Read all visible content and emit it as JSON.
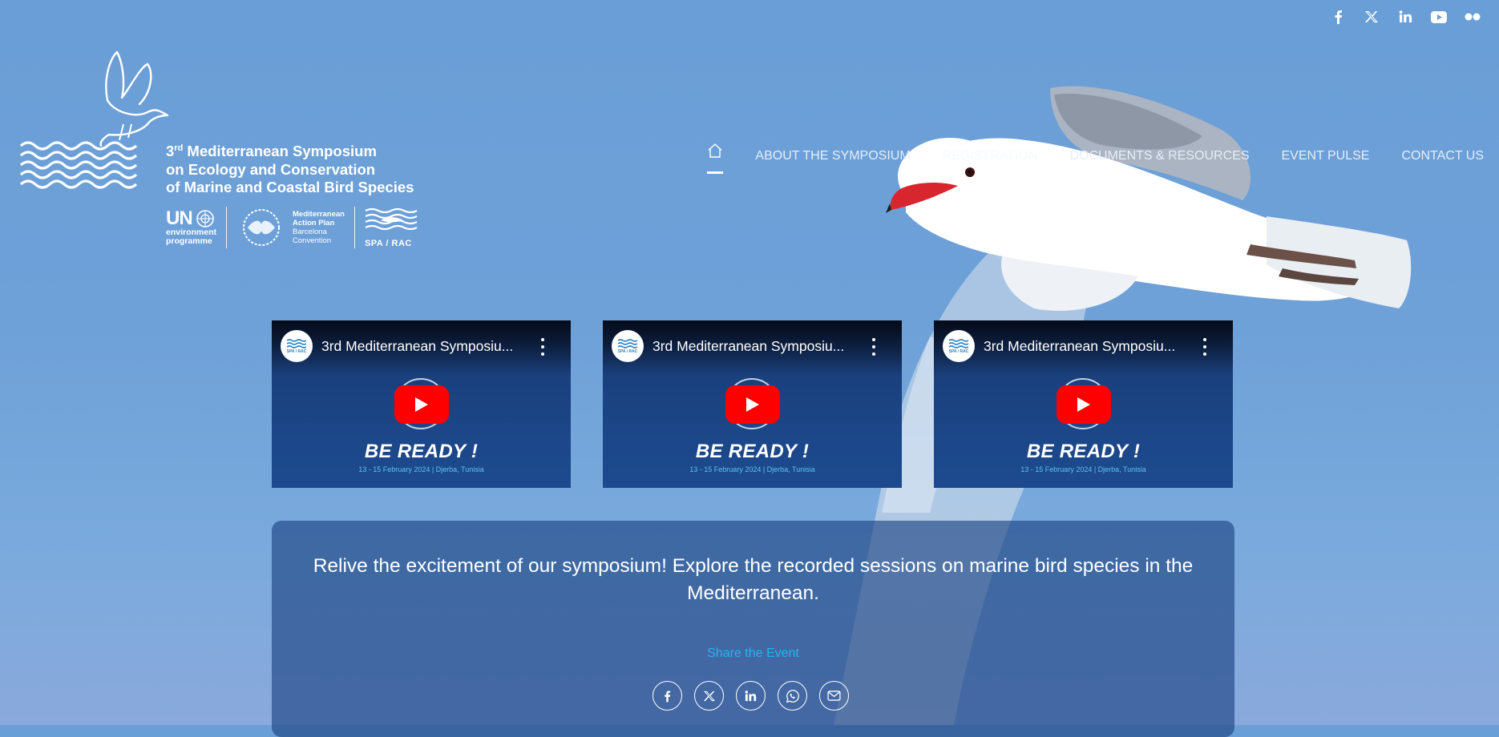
{
  "colors": {
    "sky": "#6a9ed6",
    "nav_text": "#e6eef8",
    "video_bg": "#1c4789",
    "youtube_red": "#ff0000",
    "date_blue": "#5ec3f2",
    "share_blue": "#22b4f0",
    "panel_bg": "rgba(26,64,128,.62)"
  },
  "top_social": [
    {
      "icon": "facebook-icon"
    },
    {
      "icon": "x-twitter-icon"
    },
    {
      "icon": "linkedin-icon"
    },
    {
      "icon": "youtube-icon"
    },
    {
      "icon": "flickr-icon"
    }
  ],
  "logo": {
    "title_num": "3",
    "title_sup": "rd",
    "title_line1_rest": " Mediterranean Symposium",
    "title_line2": "on Ecology and Conservation",
    "title_line3": "of Marine and Coastal Bird Species",
    "un": "UN",
    "un_sub1": "environment",
    "un_sub2": "programme",
    "map_line1": "Mediterranean",
    "map_line2": "Action Plan",
    "map_line3": "Barcelona",
    "map_line4": "Convention",
    "sparac": "SPA / RAC"
  },
  "nav": {
    "home_icon": "home-icon",
    "items": [
      "ABOUT THE SYMPOSIUM",
      "REGISTRATION",
      "DOCUMENTS & RESOURCES",
      "EVENT PULSE",
      "CONTACT US"
    ]
  },
  "videos": [
    {
      "title": "3rd Mediterranean Symposiu...",
      "ready": "BE READY !",
      "date": "13 - 15 February 2024 | Djerba, Tunisia",
      "avatar_label": "SPA / RAC"
    },
    {
      "title": "3rd Mediterranean Symposiu...",
      "ready": "BE READY !",
      "date": "13 - 15 February 2024 | Djerba, Tunisia",
      "avatar_label": "SPA / RAC"
    },
    {
      "title": "3rd Mediterranean Symposiu...",
      "ready": "BE READY !",
      "date": "13 - 15 February 2024 | Djerba, Tunisia",
      "avatar_label": "SPA / RAC"
    }
  ],
  "panel": {
    "message": "Relive the excitement of our symposium! Explore the recorded sessions on marine bird species in the Mediterranean.",
    "share_label": "Share the Event",
    "share_icons": [
      "facebook-icon",
      "x-twitter-icon",
      "linkedin-icon",
      "whatsapp-icon",
      "email-icon"
    ]
  }
}
